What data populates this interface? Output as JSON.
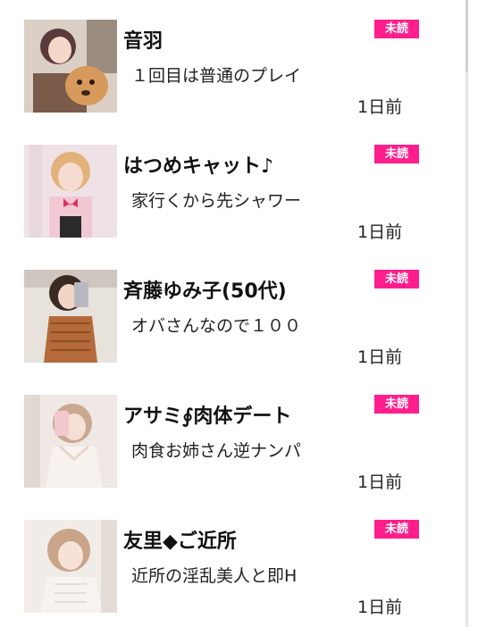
{
  "messages": [
    {
      "name": "音羽",
      "preview": "１回目は普通のプレイ",
      "badge": "未読",
      "time": "1日前"
    },
    {
      "name": "はつめキャット♪",
      "preview": "家行くから先シャワー",
      "badge": "未読",
      "time": "1日前"
    },
    {
      "name": "斉藤ゆみ子(50代)",
      "preview": "オバさんなので１００",
      "badge": "未読",
      "time": "1日前"
    },
    {
      "name": "アサミ∮肉体デート",
      "preview": "肉食お姉さん逆ナンパ",
      "badge": "未読",
      "time": "1日前"
    },
    {
      "name": "友里◆ご近所",
      "preview": "近所の淫乱美人と即H",
      "badge": "未読",
      "time": "1日前"
    }
  ],
  "colors": {
    "badge_bg": "#ff1e8c",
    "badge_text": "#ffffff"
  }
}
